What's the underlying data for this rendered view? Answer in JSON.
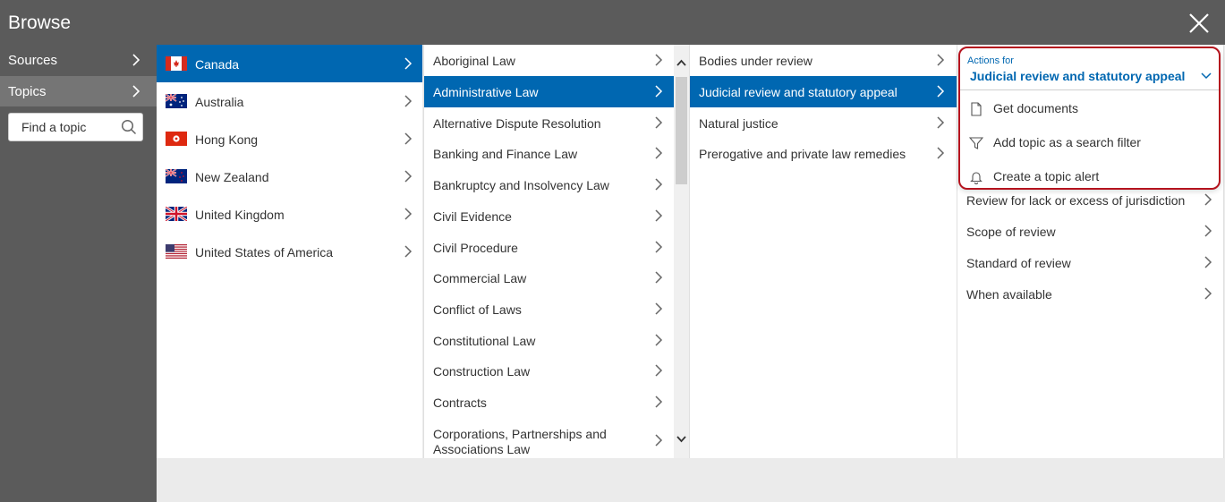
{
  "header": {
    "title": "Browse"
  },
  "leftnav": {
    "items": [
      {
        "label": "Sources"
      },
      {
        "label": "Topics"
      }
    ],
    "search_placeholder": "Find a topic"
  },
  "jurisdictions": [
    {
      "label": "Canada",
      "flag": "canada-flag",
      "selected": true
    },
    {
      "label": "Australia",
      "flag": "australia-flag"
    },
    {
      "label": "Hong Kong",
      "flag": "hong-kong-flag"
    },
    {
      "label": "New Zealand",
      "flag": "new-zealand-flag"
    },
    {
      "label": "United Kingdom",
      "flag": "united-kingdom-flag"
    },
    {
      "label": "United States of America",
      "flag": "united-states-flag"
    }
  ],
  "topics": [
    {
      "label": "Aboriginal Law"
    },
    {
      "label": "Administrative Law",
      "selected": true
    },
    {
      "label": "Alternative Dispute Resolution"
    },
    {
      "label": "Banking and Finance Law"
    },
    {
      "label": "Bankruptcy and Insolvency Law"
    },
    {
      "label": "Civil Evidence"
    },
    {
      "label": "Civil Procedure"
    },
    {
      "label": "Commercial Law"
    },
    {
      "label": "Conflict of Laws"
    },
    {
      "label": "Constitutional Law"
    },
    {
      "label": "Construction Law"
    },
    {
      "label": "Contracts"
    },
    {
      "label": "Corporations, Partnerships and",
      "label2": "Associations Law"
    }
  ],
  "subtopics": [
    {
      "label": "Bodies under review"
    },
    {
      "label": "Judicial review and statutory appeal",
      "selected": true
    },
    {
      "label": "Natural justice"
    },
    {
      "label": "Prerogative and private law remedies"
    }
  ],
  "subsubtopics": [
    {
      "label": "Review for lack or excess of jurisdiction"
    },
    {
      "label": "Scope of review"
    },
    {
      "label": "Standard of review"
    },
    {
      "label": "When available"
    }
  ],
  "popup": {
    "actions_for": "Actions for",
    "topic": "Judicial review and statutory appeal",
    "actions": [
      {
        "label": "Get documents",
        "icon": "document-icon"
      },
      {
        "label": "Add topic as a search filter",
        "icon": "filter-icon"
      },
      {
        "label": "Create a topic alert",
        "icon": "bell-icon"
      }
    ]
  },
  "colors": {
    "header_bg": "#5b5b5b",
    "accent": "#0067b1",
    "highlight": "#b5131e"
  }
}
